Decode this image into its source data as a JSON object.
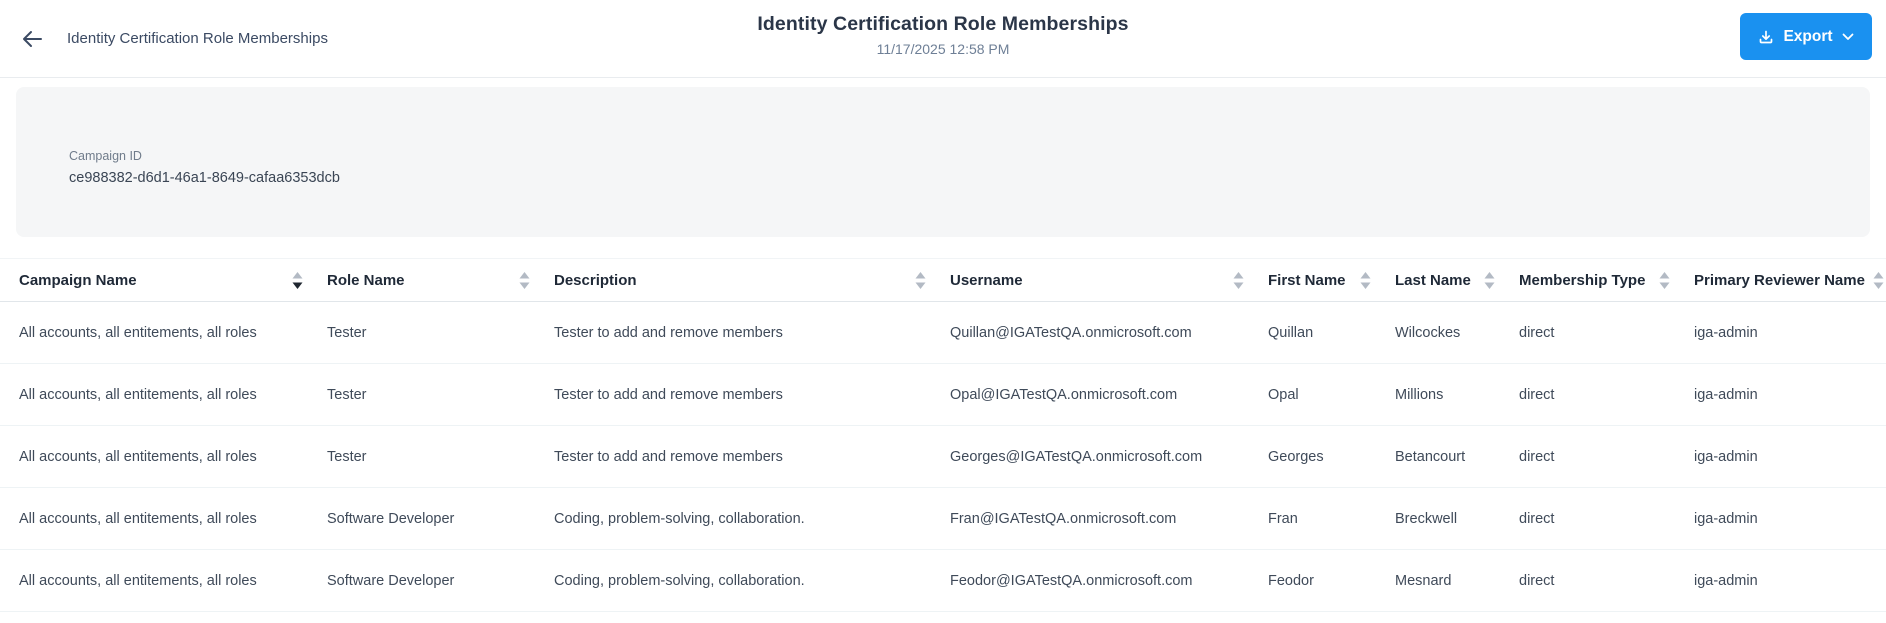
{
  "page": {
    "breadcrumb": "Identity Certification Role Memberships",
    "title": "Identity Certification Role Memberships",
    "timestamp": "11/17/2025 12:58 PM"
  },
  "toolbar": {
    "export_label": "Export"
  },
  "campaign_panel": {
    "label": "Campaign ID",
    "value": "ce988382-d6d1-46a1-8649-cafaa6353dcb"
  },
  "table": {
    "columns": [
      {
        "label": "Campaign Name",
        "sort": "desc"
      },
      {
        "label": "Role Name",
        "sort": "none"
      },
      {
        "label": "Description",
        "sort": "none"
      },
      {
        "label": "Username",
        "sort": "none"
      },
      {
        "label": "First Name",
        "sort": "none"
      },
      {
        "label": "Last Name",
        "sort": "none"
      },
      {
        "label": "Membership Type",
        "sort": "none"
      },
      {
        "label": "Primary Reviewer Name",
        "sort": "none"
      }
    ],
    "rows": [
      [
        "All accounts, all entitements, all roles",
        "Tester",
        "Tester to add and remove members",
        "Quillan@IGATestQA.onmicrosoft.com",
        "Quillan",
        "Wilcockes",
        "direct",
        "iga-admin"
      ],
      [
        "All accounts, all entitements, all roles",
        "Tester",
        "Tester to add and remove members",
        "Opal@IGATestQA.onmicrosoft.com",
        "Opal",
        "Millions",
        "direct",
        "iga-admin"
      ],
      [
        "All accounts, all entitements, all roles",
        "Tester",
        "Tester to add and remove members",
        "Georges@IGATestQA.onmicrosoft.com",
        "Georges",
        "Betancourt",
        "direct",
        "iga-admin"
      ],
      [
        "All accounts, all entitements, all roles",
        "Software Developer",
        "Coding, problem-solving, collaboration.",
        "Fran@IGATestQA.onmicrosoft.com",
        "Fran",
        "Breckwell",
        "direct",
        "iga-admin"
      ],
      [
        "All accounts, all entitements, all roles",
        "Software Developer",
        "Coding, problem-solving, collaboration.",
        "Feodor@IGATestQA.onmicrosoft.com",
        "Feodor",
        "Mesnard",
        "direct",
        "iga-admin"
      ]
    ]
  },
  "icons": {
    "back": "back-arrow-icon",
    "export": "download-icon",
    "export_menu": "chevron-down-icon",
    "column_sort": "sort-icon"
  },
  "colors": {
    "accent_blue": "#1a91f0",
    "title_text": "#2b3648",
    "panel_bg": "#f5f6f7",
    "header_text": "#1f2937",
    "cell_text": "#3f4a59",
    "sort_inactive": "#b3bac4",
    "sort_active": "#1f2630"
  }
}
